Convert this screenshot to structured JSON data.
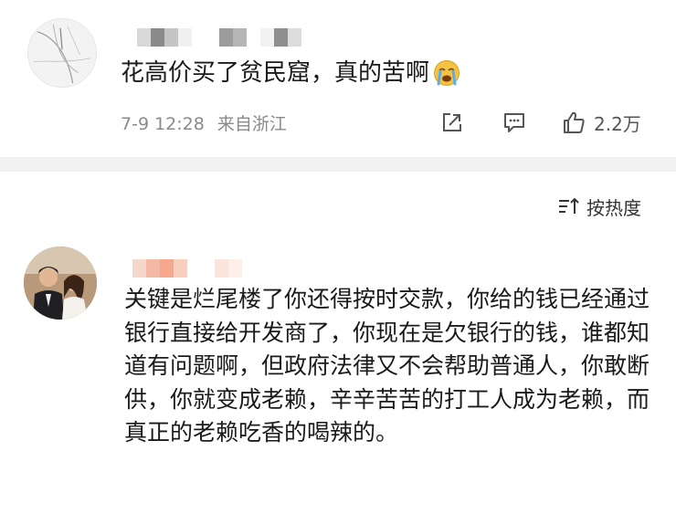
{
  "post": {
    "text": "花高价买了贫民窟，真的苦啊",
    "emoji": "crying-emoji",
    "time": "7-9 12:28",
    "source": "来自浙江",
    "actions": {
      "share_icon": "share-icon",
      "comment_icon": "comment-icon",
      "like_icon": "thumbs-up-icon",
      "like_count": "2.2万"
    }
  },
  "sort": {
    "icon": "sort-icon",
    "label": "按热度"
  },
  "comment": {
    "text": "关键是烂尾楼了你还得按时交款，你给的钱已经通过银行直接给开发商了，你现在是欠银行的钱，谁都知道有问题啊，但政府法律又不会帮助普通人，你敢断供，你就变成老赖，辛辛苦苦的打工人成为老赖，而真正的老赖吃香的喝辣的。"
  },
  "colors": {
    "text": "#1a1a1a",
    "meta": "#8a8a8a",
    "divider": "#f1f1f1",
    "icon": "#555555"
  }
}
